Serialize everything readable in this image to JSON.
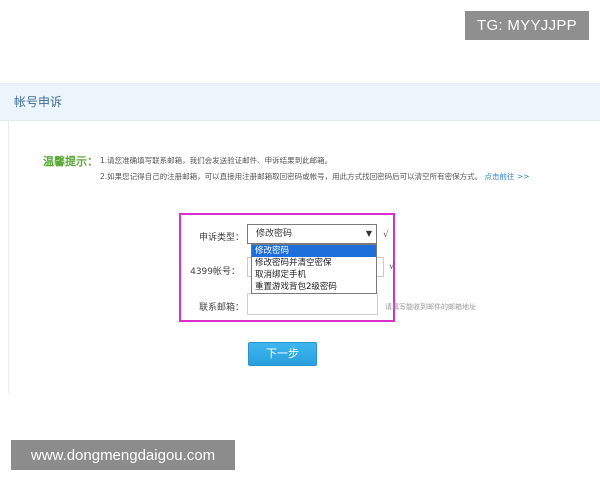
{
  "watermark_top": "TG: MYYJJPP",
  "watermark_bottom": "www.dongmengdaigou.com",
  "panel": {
    "title": "帐号申诉"
  },
  "tips": {
    "label": "温馨提示：",
    "line1": "1.请您准确填写联系邮箱，我们会发送验证邮件、申诉结果到此邮箱。",
    "line2": "2.如果您记得自己的注册邮箱，可以直接用注册邮箱取回密码或帐号，用此方式找回密码后可以清空所有密保方式。",
    "link": "点击前往 >>"
  },
  "form": {
    "type_label": "申诉类型：",
    "type_value": "修改密码",
    "type_arrow": "▼",
    "check": "√",
    "account_label": "4399帐号：",
    "email_label": "联系邮箱：",
    "email_hint": "请填写能收到邮件的邮箱地址",
    "dropdown_options": [
      "修改密码",
      "修改密码并清空密保",
      "取消绑定手机",
      "重置游戏背包2级密码"
    ],
    "next_button": "下一步"
  }
}
